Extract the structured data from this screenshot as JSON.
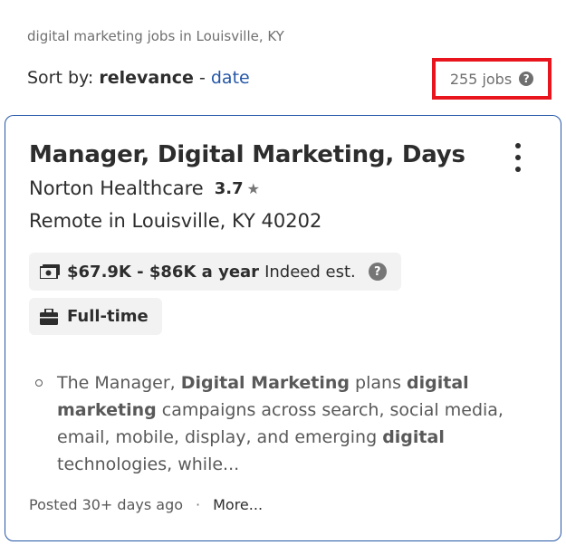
{
  "search": {
    "label": "digital marketing jobs in Louisville, KY"
  },
  "sort": {
    "prefix": "Sort by:",
    "active": "relevance",
    "separator": "-",
    "alt": "date"
  },
  "job_count": {
    "text": "255 jobs"
  },
  "job": {
    "title": "Manager, Digital Marketing, Days",
    "company": "Norton Healthcare",
    "rating": "3.7",
    "location": "Remote in Louisville, KY 40202",
    "salary": "$67.9K - $86K a year",
    "salary_note": "Indeed est.",
    "job_type": "Full-time",
    "snippet_parts": [
      "The Manager, ",
      "Digital Marketing",
      " plans ",
      "digital",
      " ",
      "marketing",
      " campaigns across search, social media, email, mobile, display, and emerging ",
      "digital",
      " technologies, while..."
    ],
    "posted": "Posted 30+ days ago",
    "more": "More..."
  },
  "colors": {
    "link": "#2557a7",
    "highlight_border": "#e8141e",
    "chip_bg": "#f2f2f2"
  },
  "icons": [
    "question-icon",
    "more-vertical-icon",
    "star-icon",
    "money-icon",
    "briefcase-icon"
  ]
}
